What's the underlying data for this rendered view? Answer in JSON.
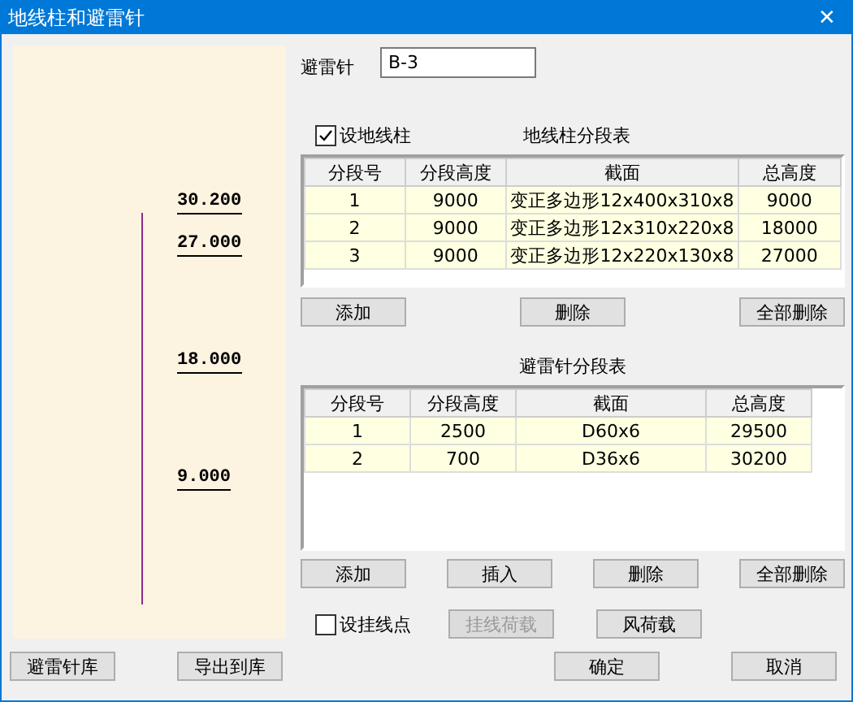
{
  "window": {
    "title": "地线柱和避雷针",
    "close": "✕"
  },
  "elevations": [
    "30.200",
    "27.000",
    "18.000",
    "9.000"
  ],
  "rod": {
    "label": "避雷针",
    "value": "B-3"
  },
  "ground_column": {
    "checkbox": {
      "label": "设地线柱",
      "checked": true
    },
    "title": "地线柱分段表",
    "columns": [
      "分段号",
      "分段高度",
      "截面",
      "总高度"
    ],
    "rows": [
      [
        "1",
        "9000",
        "变正多边形12x400x310x8",
        "9000"
      ],
      [
        "2",
        "9000",
        "变正多边形12x310x220x8",
        "18000"
      ],
      [
        "3",
        "9000",
        "变正多边形12x220x130x8",
        "27000"
      ]
    ],
    "buttons": [
      {
        "label": "添加",
        "disabled": false
      },
      {
        "label": "删除",
        "disabled": false
      },
      {
        "label": "全部删除",
        "disabled": false
      }
    ]
  },
  "rod_table": {
    "title": "避雷针分段表",
    "columns": [
      "分段号",
      "分段高度",
      "截面",
      "总高度"
    ],
    "rows": [
      [
        "1",
        "2500",
        "D60x6",
        "29500"
      ],
      [
        "2",
        "700",
        "D36x6",
        "30200"
      ]
    ],
    "buttons": [
      {
        "label": "添加",
        "disabled": false
      },
      {
        "label": "插入",
        "disabled": false
      },
      {
        "label": "删除",
        "disabled": false
      },
      {
        "label": "全部删除",
        "disabled": false
      }
    ]
  },
  "wire_point": {
    "label": "设挂线点",
    "checked": false
  },
  "load_buttons": [
    {
      "label": "挂线荷载",
      "disabled": true
    },
    {
      "label": "风荷载",
      "disabled": false
    }
  ],
  "footer_left": [
    {
      "label": "避雷针库",
      "disabled": false
    },
    {
      "label": "导出到库",
      "disabled": false
    }
  ],
  "footer_right": [
    {
      "label": "确定",
      "disabled": false
    },
    {
      "label": "取消",
      "disabled": false
    }
  ]
}
